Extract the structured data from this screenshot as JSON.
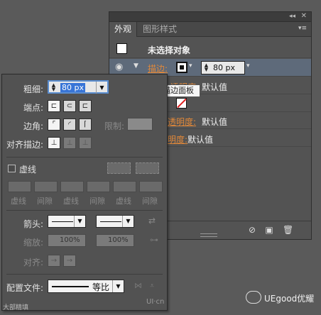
{
  "appearance": {
    "tabs": [
      "外观",
      "图形样式"
    ],
    "no_selection": "未选择对象",
    "stroke_label": "描边:",
    "stroke_value": "80 px",
    "opacity_label": "透明度:",
    "opacity_value": "默认值",
    "opacity2_label": "透明度:",
    "opacity2_value": "默认值",
    "opacity3_label": "明度:",
    "opacity3_value": "默认值",
    "tooltip": "描边面板",
    "tooltip_row_value": "默认值"
  },
  "stroke_panel": {
    "weight_label": "粗细:",
    "weight_value": "80 px",
    "cap_label": "端点:",
    "corner_label": "边角:",
    "limit_label": "限制:",
    "align_label": "对齐描边:",
    "dashed_label": "虚线",
    "dash_labels": [
      "虚线",
      "间隙",
      "虚线",
      "间隙",
      "虚线",
      "间隙"
    ],
    "arrow_label": "箭头:",
    "scale_label": "缩放:",
    "scale_value1": "100%",
    "scale_value2": "100%",
    "align2_label": "对齐:",
    "profile_label": "配置文件:",
    "profile_value": "等比"
  },
  "watermarks": {
    "left": "大部精填",
    "right": "UEgood优耀",
    "right_sub": "UI·cn"
  },
  "colors": {
    "accent": "#e0883a",
    "selected_row": "#5e6a7a",
    "panel": "#535353"
  }
}
